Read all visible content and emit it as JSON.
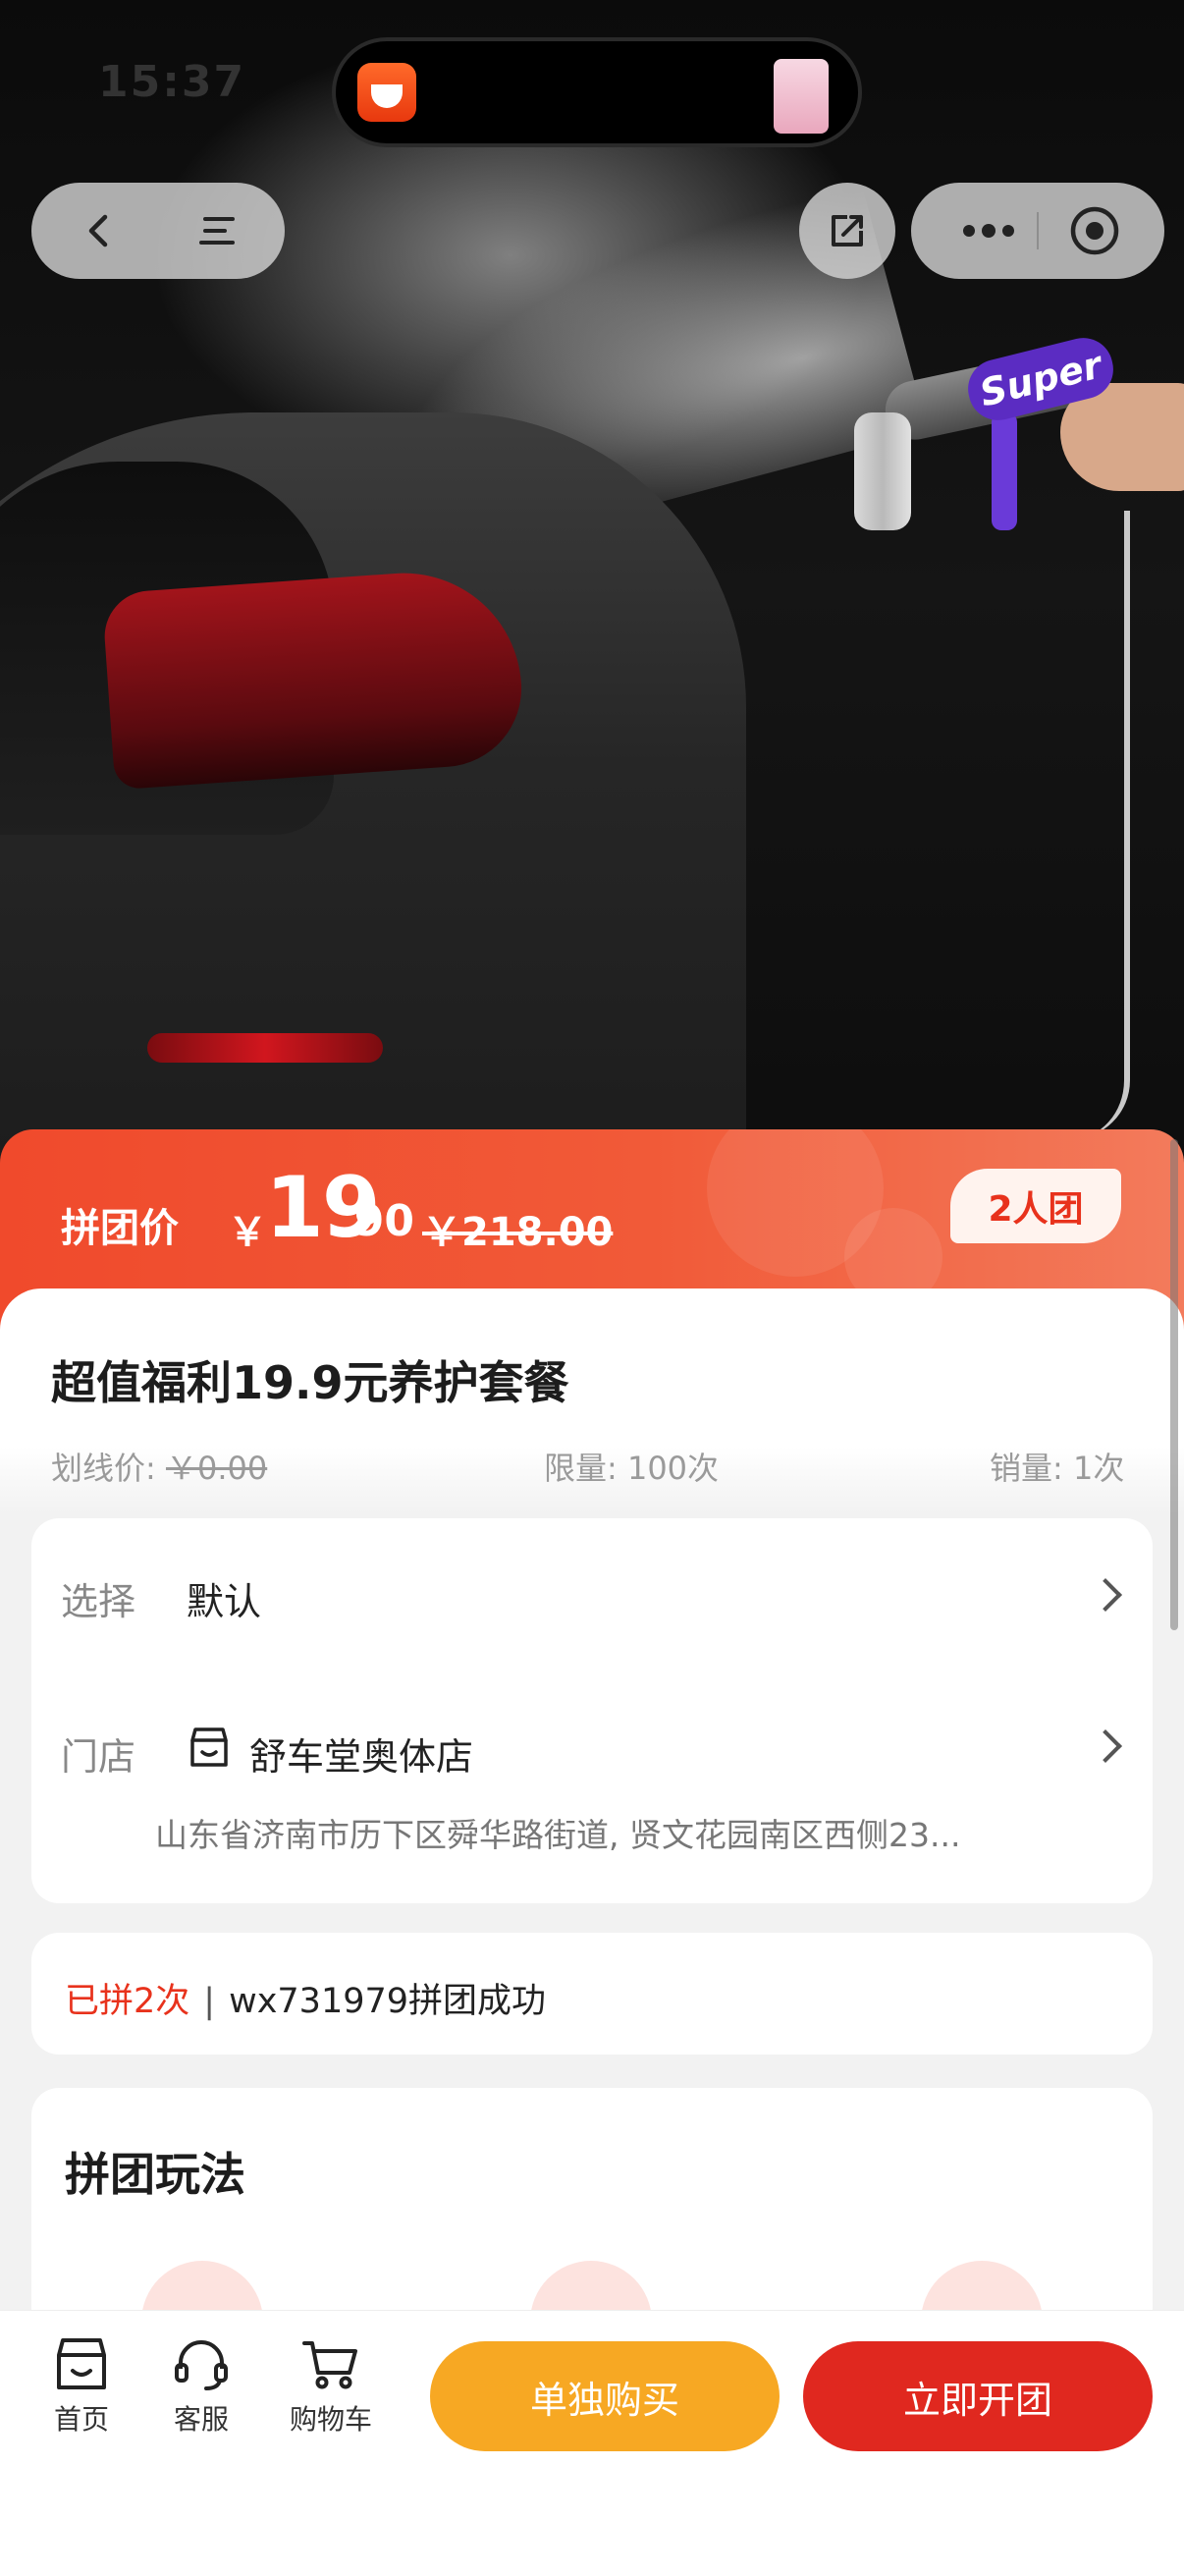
{
  "status_bar": {
    "time": "15:37"
  },
  "hero": {
    "gun_brand": "Super"
  },
  "price": {
    "label": "拼团价",
    "currency": "￥",
    "integer": "19",
    "decimal": ".90",
    "original": "￥218.00",
    "team_badge": "2人团"
  },
  "product": {
    "title": "超值福利19.9元养护套餐",
    "list_price_label": "划线价:",
    "list_price_value": "￥0.00",
    "limit": "限量: 100次",
    "sales": "销量: 1次"
  },
  "options": {
    "select_label": "选择",
    "select_value": "默认",
    "store_label": "门店",
    "store_name": "舒车堂奥体店",
    "store_address": "山东省济南市历下区舜华路街道, 贤文花园南区西侧23..."
  },
  "group_status": {
    "count_text": "已拼2次",
    "separator": "|",
    "user_text": "wx731979拼团成功"
  },
  "rules": {
    "title": "拼团玩法"
  },
  "tabbar": {
    "home": "首页",
    "service": "客服",
    "cart": "购物车"
  },
  "actions": {
    "buy_alone": "单独购买",
    "start_group": "立即开团"
  },
  "colors": {
    "accent_red": "#e0281f",
    "accent_orange": "#f7a823",
    "price_band": "#f04a2c"
  }
}
